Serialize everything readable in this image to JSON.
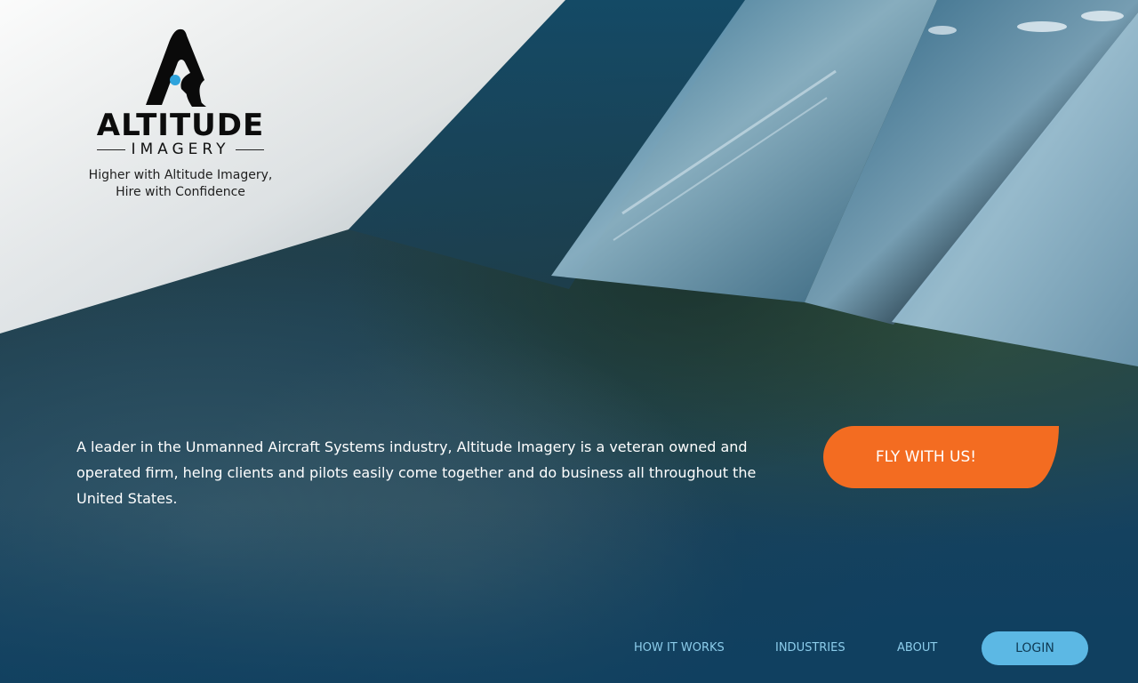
{
  "brand": {
    "name": "ALTITUDE",
    "sub": "IMAGERY",
    "tagline_line1": "Higher with Altitude Imagery,",
    "tagline_line2": "Hire with Confidence",
    "accent_color": "#2ea3dc"
  },
  "hero": {
    "intro": "A leader in the Unmanned Aircraft Systems industry, Altitude Imagery is a veteran owned and operated firm, helng clients and pilots easily come together and do business all throughout the United States.",
    "cta_label": "FLY WITH US!",
    "cta_color": "#f36c21"
  },
  "nav": {
    "items": [
      {
        "label": "HOW IT WORKS"
      },
      {
        "label": "INDUSTRIES"
      },
      {
        "label": "ABOUT"
      }
    ],
    "login_label": "LOGIN",
    "login_color": "#5cb8e4"
  }
}
